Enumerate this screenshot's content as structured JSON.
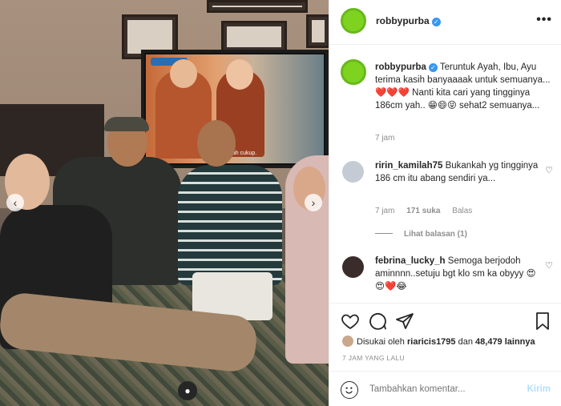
{
  "post": {
    "author": "robbypurba",
    "verified": true,
    "more_icon": "more-horizontal-icon",
    "caption_text": "Teruntuk Ayah, Ibu, Ayu terima kasih banyaaaak untuk semuanya... ❤️❤️❤️ Nanti kita cari yang tingginya 186cm yah.. 😁😄😝 sehat2 semuanya...",
    "caption_time": "7 jam",
    "photo_tv_text": "aah cukup."
  },
  "comments": [
    {
      "user": "ririn_kamilah75",
      "text": "Bukankah yg tingginya 186 cm itu abang sendiri ya...",
      "time": "7 jam",
      "likes": "171 suka",
      "reply": "Balas",
      "view_replies": "Lihat balasan (1)"
    },
    {
      "user": "febrina_lucky_h",
      "text": "Semoga berjodoh aminnnn..setuju bgt klo sm ka obyyy 😍😍❤️😂"
    }
  ],
  "actions": {
    "like_icon": "heart-icon",
    "comment_icon": "comment-icon",
    "share_icon": "share-icon",
    "save_icon": "bookmark-icon"
  },
  "likes": {
    "prefix": "Disukai oleh",
    "user": "riaricis1795",
    "middle": "dan",
    "count": "48,479 lainnya"
  },
  "timestamp": "7 JAM YANG LALU",
  "composer": {
    "placeholder": "Tambahkan komentar...",
    "send_label": "Kirim"
  },
  "colors": {
    "accent_avatar": "#7ed321",
    "verified": "#3897f0",
    "send_disabled": "#b2dffc"
  }
}
